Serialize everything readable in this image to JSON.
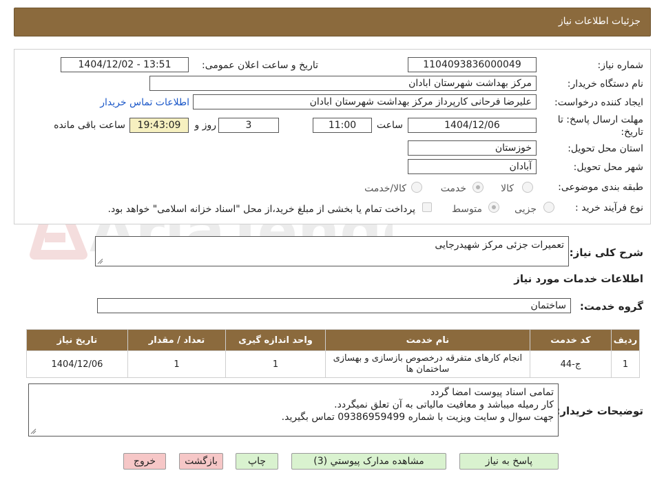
{
  "header": {
    "title": "جزئیات اطلاعات نیاز"
  },
  "form": {
    "need_number_label": "شماره نیاز:",
    "need_number": "1104093836000049",
    "announce_label": "تاریخ و ساعت اعلان عمومی:",
    "announce_value": "1404/12/02 - 13:51",
    "buyer_org_label": "نام دستگاه خریدار:",
    "buyer_org": "مرکز بهداشت شهرستان ابادان",
    "requester_label": "ایجاد کننده درخواست:",
    "requester": "علیرضا فرحانی کارپرداز مرکز بهداشت شهرستان ابادان",
    "contact_link": "اطلاعات تماس خریدار",
    "deadline_label_1": "مهلت ارسال پاسخ: تا",
    "deadline_label_2": "تاریخ:",
    "deadline_date": "1404/12/06",
    "time_label": "ساعت",
    "deadline_time": "11:00",
    "days_value": "3",
    "days_label": "روز و",
    "remaining_time": "19:43:09",
    "remaining_label": "ساعت باقی مانده",
    "province_label": "استان محل تحویل:",
    "province": "خوزستان",
    "city_label": "شهر محل تحویل:",
    "city": "آبادان",
    "category_label": "طبقه بندی موضوعی:",
    "category_options": [
      "کالا",
      "خدمت",
      "کالا/خدمت"
    ],
    "process_label": "نوع فرآیند خرید :",
    "process_options": [
      "جزیی",
      "متوسط"
    ],
    "payment_note": "پرداخت تمام یا بخشی از مبلغ خرید،از محل \"اسناد خزانه اسلامی\" خواهد بود."
  },
  "summary": {
    "label": "شرح کلی نیاز:",
    "value": "تعمیرات جزئی مرکز شهیدرجایی"
  },
  "services": {
    "title": "اطلاعات خدمات مورد نیاز",
    "group_label": "گروه خدمت:",
    "group_value": "ساختمان",
    "columns": [
      "ردیف",
      "کد خدمت",
      "نام خدمت",
      "واحد اندازه گیری",
      "تعداد / مقدار",
      "تاریخ نیاز"
    ],
    "rows": [
      [
        "1",
        "ج-44",
        "انجام کارهای متفرقه درخصوص بازسازی و بهسازی ساختمان ها",
        "1",
        "1",
        "1404/12/06"
      ]
    ]
  },
  "buyer_notes": {
    "label": "توضیحات خریدار:",
    "lines": [
      "تمامی اسناد پیوست امضا گردد",
      "کار رمیله میباشد و معافیت مالیاتی به آن تعلق نمیگردد.",
      "جهت سوال و سایت ویزیت با شماره 09386959499 تماس بگیرید."
    ]
  },
  "buttons": {
    "reply": "پاسخ به نیاز",
    "attachments": "مشاهده مدارک پیوستي (3)",
    "print": "چاپ",
    "back": "بازگشت",
    "exit": "خروج"
  },
  "watermark": {
    "text": "AriaTender.neT"
  },
  "colors": {
    "header": "#8b6a3d",
    "button_green": "#d9f2cf",
    "button_pink": "#f6c7c7",
    "time_highlight": "#f6f0c0",
    "link": "#1a57c8"
  }
}
